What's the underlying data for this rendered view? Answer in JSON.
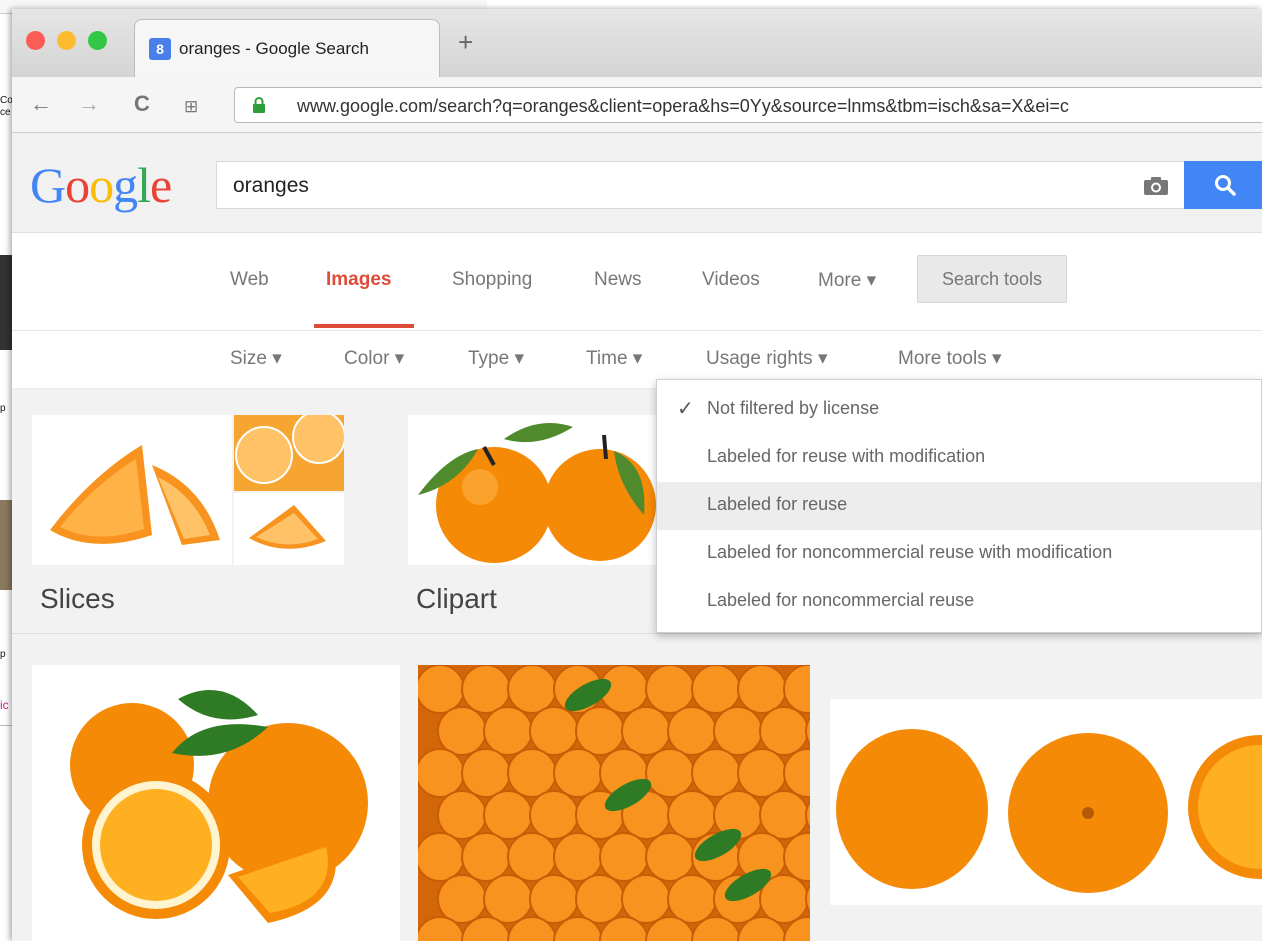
{
  "background_window": {
    "fragments": [
      "Co",
      "ce",
      "p",
      "p",
      "ic"
    ]
  },
  "browser": {
    "tab_title": "oranges - Google Search",
    "favicon": "google-favicon",
    "new_tab_icon": "+",
    "url": "www.google.com/search?q=oranges&client=opera&hs=0Yy&source=lnms&tbm=isch&sa=X&ei=c"
  },
  "search": {
    "logo_letters": [
      "G",
      "o",
      "o",
      "g",
      "l",
      "e"
    ],
    "logo_colors": [
      "#4285f4",
      "#ea4335",
      "#fbbc05",
      "#4285f4",
      "#34a853",
      "#ea4335"
    ],
    "query": "oranges"
  },
  "nav_tabs": [
    {
      "label": "Web",
      "active": false
    },
    {
      "label": "Images",
      "active": true
    },
    {
      "label": "Shopping",
      "active": false
    },
    {
      "label": "News",
      "active": false
    },
    {
      "label": "Videos",
      "active": false
    },
    {
      "label": "More ▾",
      "active": false
    }
  ],
  "search_tools_label": "Search tools",
  "filters": [
    "Size ▾",
    "Color ▾",
    "Type ▾",
    "Time ▾",
    "Usage rights ▾",
    "More tools ▾"
  ],
  "categories": [
    {
      "label": "Slices"
    },
    {
      "label": "Clipart"
    }
  ],
  "usage_rights_menu": [
    {
      "label": "Not filtered by license",
      "checked": true,
      "highlighted": false
    },
    {
      "label": "Labeled for reuse with modification",
      "checked": false,
      "highlighted": false
    },
    {
      "label": "Labeled for reuse",
      "checked": false,
      "highlighted": true
    },
    {
      "label": "Labeled for noncommercial reuse with modification",
      "checked": false,
      "highlighted": false
    },
    {
      "label": "Labeled for noncommercial reuse",
      "checked": false,
      "highlighted": false
    }
  ],
  "colors": {
    "accent_red": "#dd4b39",
    "search_blue": "#4285f4",
    "orange": "#f7931e"
  }
}
